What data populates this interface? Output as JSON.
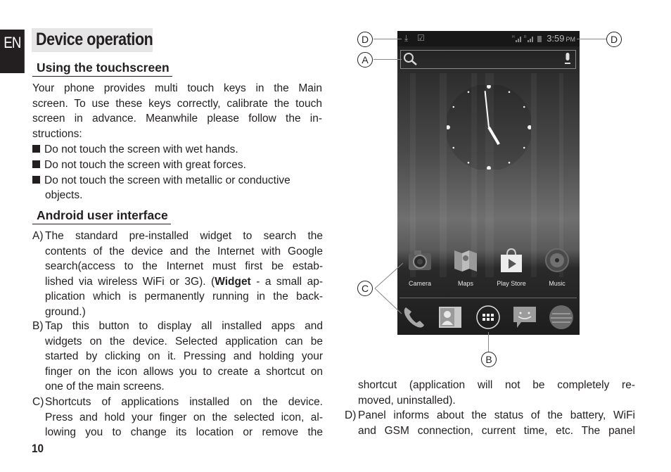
{
  "language_tab": "EN",
  "page_title": "Device operation",
  "sections": {
    "touchscreen": {
      "heading": "Using the touchscreen",
      "paragraph_lines": [
        "Your phone provides multi touch keys in the Main",
        "screen. To use these keys correctly, calibrate the touch",
        "screen in advance. Meanwhile please follow the in-",
        "structions:"
      ],
      "bullets": [
        "Do not touch the screen with wet hands.",
        "Do not touch the screen with great forces.",
        "Do not touch the screen with metallic or conductive",
        "objects."
      ]
    },
    "android_ui": {
      "heading": "Android user interface",
      "items": [
        {
          "marker": "A)",
          "lines": [
            "The standard pre-installed widget to search the",
            "contents of the device and the Internet with Google",
            "search(access to the Internet must first be estab-",
            "lished via wireless WiFi or 3G). (",
            "Widget",
            " - a small ap-",
            "plication which is permanently running in the back-",
            "ground.)"
          ]
        },
        {
          "marker": "B)",
          "lines": [
            "Tap this button to display all installed apps and",
            "widgets on the device. Selected application can be",
            "started by clicking on it. Pressing and holding your",
            "finger on the icon allows you to create a shortcut on",
            "one of the main screens."
          ]
        },
        {
          "marker": "C)",
          "lines": [
            "Shortcuts of applications installed on the device.",
            "Press and hold your finger on the selected icon, al-",
            "lowing you to change its location or remove the",
            "shortcut (application will not be completely re-",
            "moved, uninstalled)."
          ]
        },
        {
          "marker": "D)",
          "lines": [
            "Panel informs about the status of the battery, WiFi",
            "and GSM connection, current time, etc. The panel"
          ]
        }
      ]
    }
  },
  "page_number": "10",
  "phone_screen": {
    "status_bar": {
      "left_icons": [
        "download-icon",
        "clipboard-check-icon"
      ],
      "right_icons": [
        "signal-h-icon",
        "signal-r-icon",
        "battery-icon"
      ],
      "time": "3:59",
      "ampm": "PM"
    },
    "search_bar": {
      "icons": [
        "search-icon",
        "microphone-icon"
      ]
    },
    "clock_widget": {
      "hour": 4,
      "minute": 59
    },
    "apps": [
      "Camera",
      "Maps",
      "Play Store",
      "Music"
    ],
    "dock": [
      "Phone",
      "Contacts",
      "All apps",
      "Messaging",
      "Browser"
    ]
  },
  "callouts": {
    "a": "A",
    "b": "B",
    "c": "C",
    "d_left": "D",
    "d_right": "D"
  }
}
